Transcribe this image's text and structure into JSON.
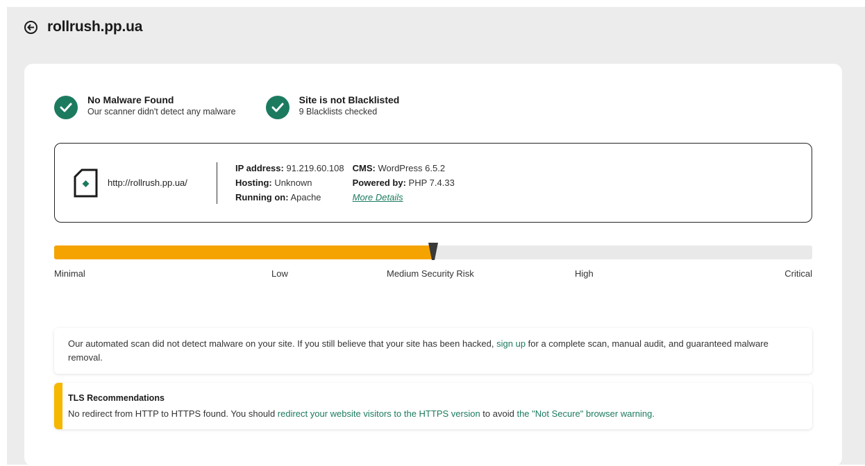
{
  "header": {
    "title": "rollrush.pp.ua",
    "back_icon": "arrow-left-circle-icon"
  },
  "status": [
    {
      "title": "No Malware Found",
      "subtitle": "Our scanner didn't detect any malware",
      "icon": "check-circle-icon"
    },
    {
      "title": "Site is not Blacklisted",
      "subtitle": "9 Blacklists checked",
      "icon": "check-circle-icon"
    }
  ],
  "site_info": {
    "url": "http://rollrush.pp.ua/",
    "ip_label": "IP address:",
    "ip_value": "91.219.60.108",
    "hosting_label": "Hosting:",
    "hosting_value": "Unknown",
    "running_label": "Running on:",
    "running_value": "Apache",
    "cms_label": "CMS:",
    "cms_value": "WordPress 6.5.2",
    "powered_label": "Powered by:",
    "powered_value": "PHP 7.4.33",
    "more_details": "More Details"
  },
  "risk": {
    "level_fraction": 0.5,
    "labels": [
      "Minimal",
      "Low",
      "Medium Security Risk",
      "High",
      "Critical"
    ],
    "fill_color": "#f5a300"
  },
  "notice": {
    "text_before": "Our automated scan did not detect malware on your site. If you still believe that your site has been hacked, ",
    "link": "sign up",
    "text_after": " for a complete scan, manual audit, and guaranteed malware removal."
  },
  "tls": {
    "title": "TLS Recommendations",
    "text_before": "No redirect from HTTP to HTTPS found. You should ",
    "link1": "redirect your website visitors to the HTTPS version",
    "text_middle": " to avoid ",
    "link2": "the \"Not Secure\" browser warning."
  },
  "colors": {
    "accent": "#1c7a5f",
    "warning": "#f5b700",
    "background": "#ececec"
  }
}
